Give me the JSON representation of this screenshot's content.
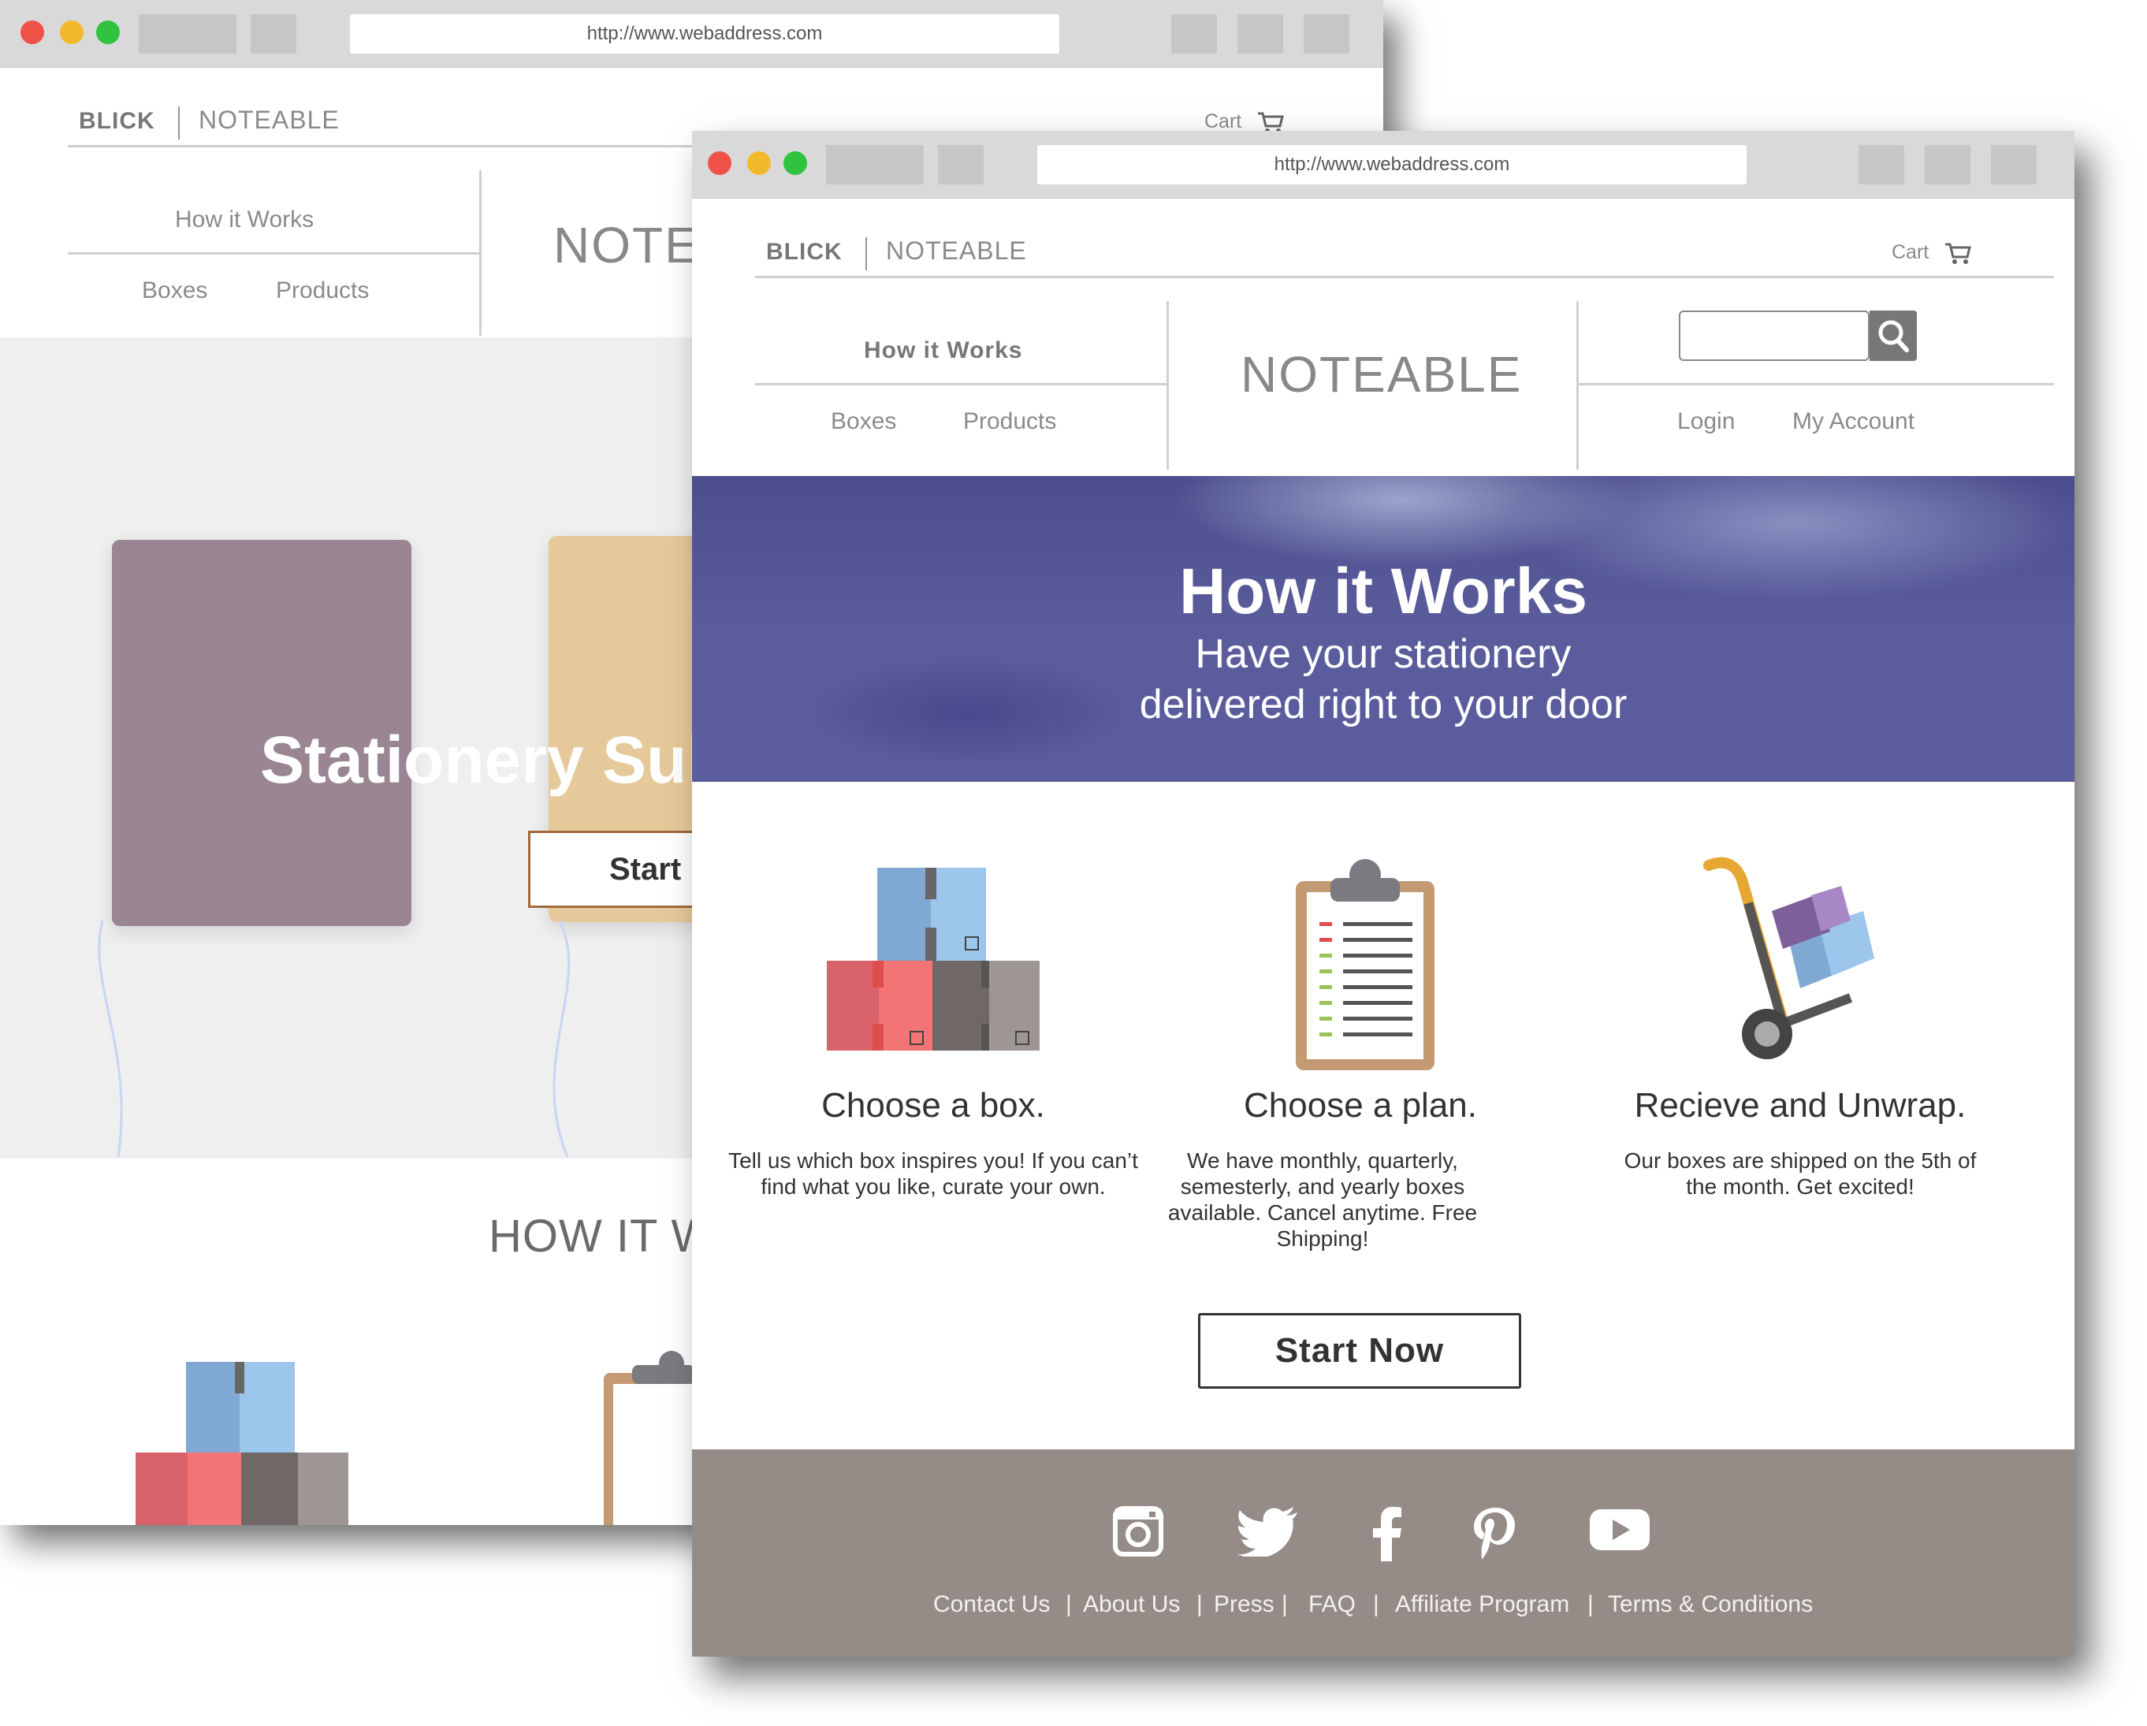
{
  "browser": {
    "url": "http://www.webaddress.com"
  },
  "site": {
    "brand": "BLICK",
    "name": "NOTEABLE",
    "cart_label": "Cart",
    "logo": "NOTEABLE"
  },
  "nav": {
    "how_it_works": "How it Works",
    "boxes": "Boxes",
    "products": "Products",
    "login": "Login",
    "my_account": "My Account"
  },
  "back_page": {
    "logo_partial": "NOTE",
    "hero_title_partial": "Stationery Sub",
    "hero_button_partial": "Start",
    "section_title_partial": "HOW IT W"
  },
  "hero": {
    "title": "How it Works",
    "subtitle_line1": "Have your stationery",
    "subtitle_line2": "delivered right to your door"
  },
  "steps": [
    {
      "title": "Choose a box.",
      "text": "Tell us which box inspires you! If you can’t find what you like, curate your own."
    },
    {
      "title": "Choose a plan.",
      "text": "We have monthly, quarterly, semesterly, and yearly boxes available. Cancel anytime. Free Shipping!"
    },
    {
      "title": "Recieve and Unwrap.",
      "text": "Our boxes are shipped on the 5th of the month. Get excited!"
    }
  ],
  "cta": {
    "label": "Start Now"
  },
  "footer": {
    "social": [
      "instagram-icon",
      "twitter-icon",
      "facebook-icon",
      "pinterest-icon",
      "youtube-icon"
    ],
    "links": [
      "Contact Us",
      "About Us",
      "Press",
      "FAQ",
      "Affiliate Program",
      "Terms & Conditions"
    ],
    "separator": "|"
  },
  "colors": {
    "hero_bg": "#5a5c9c",
    "footer_bg": "#958c87",
    "close": "#f0524a",
    "minimize": "#f4b92b",
    "maximize": "#2fc33f"
  }
}
